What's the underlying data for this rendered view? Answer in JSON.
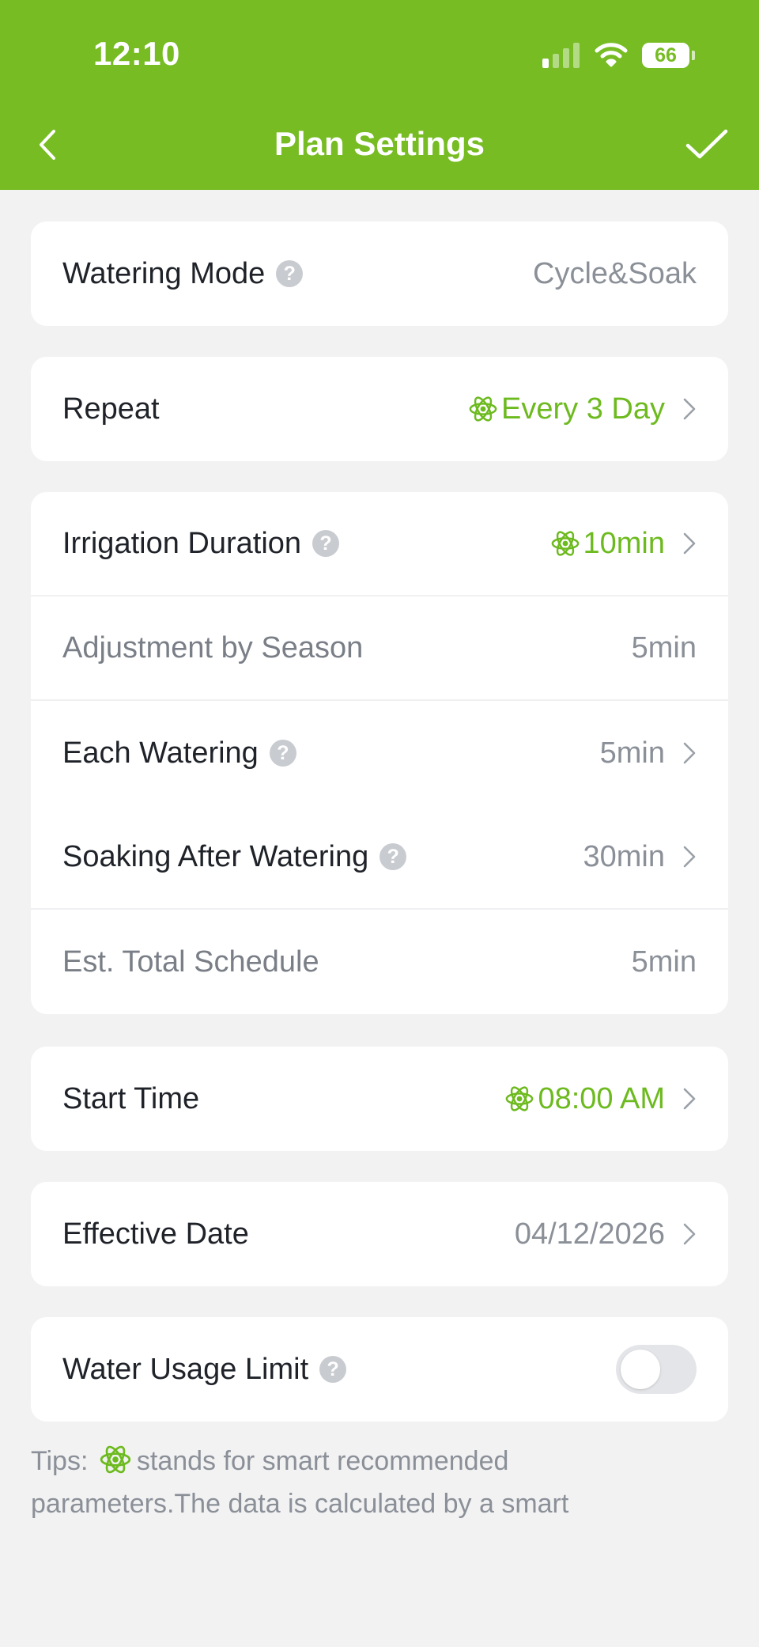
{
  "status_bar": {
    "time": "12:10",
    "battery": "66"
  },
  "header": {
    "title": "Plan Settings"
  },
  "rows": {
    "watering_mode": {
      "label": "Watering Mode",
      "value": "Cycle&Soak"
    },
    "repeat": {
      "label": "Repeat",
      "value": "Every 3 Day"
    },
    "irrigation_duration": {
      "label": "Irrigation Duration",
      "value": "10min"
    },
    "adjustment_by_season": {
      "label": "Adjustment by Season",
      "value": "5min"
    },
    "each_watering": {
      "label": "Each Watering",
      "value": "5min"
    },
    "soaking_after_watering": {
      "label": "Soaking After Watering",
      "value": "30min"
    },
    "est_total_schedule": {
      "label": "Est. Total Schedule",
      "value": "5min"
    },
    "start_time": {
      "label": "Start Time",
      "value": "08:00 AM"
    },
    "effective_date": {
      "label": "Effective Date",
      "value": "04/12/2026"
    },
    "water_usage_limit": {
      "label": "Water Usage Limit",
      "enabled": false
    }
  },
  "help_glyph": "?",
  "tips": {
    "prefix": "Tips:",
    "text": "stands for smart recommended parameters.The data is calculated by a smart"
  },
  "colors": {
    "brand": "#76bc22",
    "accent_text": "#6dba1f",
    "background": "#f2f2f3"
  },
  "icons": [
    "back-arrow-icon",
    "checkmark-icon",
    "help-icon",
    "smart-atom-icon",
    "chevron-right-icon"
  ]
}
